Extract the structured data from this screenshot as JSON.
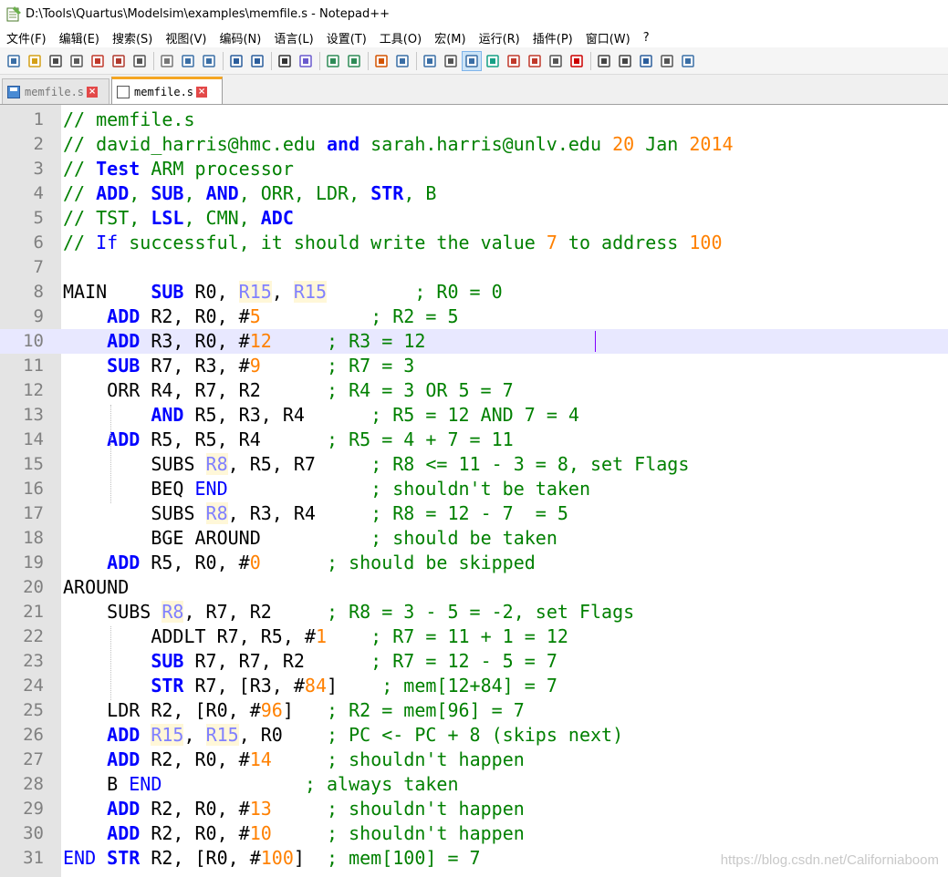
{
  "window": {
    "title": "D:\\Tools\\Quartus\\Modelsim\\examples\\memfile.s - Notepad++"
  },
  "menu": [
    "文件(F)",
    "编辑(E)",
    "搜索(S)",
    "视图(V)",
    "编码(N)",
    "语言(L)",
    "设置(T)",
    "工具(O)",
    "宏(M)",
    "运行(R)",
    "插件(P)",
    "窗口(W)",
    "?"
  ],
  "toolbar": {
    "buttons": [
      "new-file-icon",
      "open-file-icon",
      "save-icon",
      "save-all-icon",
      "close-icon",
      "close-all-icon",
      "print-icon",
      "sep",
      "cut-icon",
      "copy-icon",
      "paste-icon",
      "sep",
      "undo-icon",
      "redo-icon",
      "sep",
      "find-icon",
      "replace-icon",
      "sep",
      "zoom-in-icon",
      "zoom-out-icon",
      "sep",
      "sync-vertical-icon",
      "sync-horizontal-icon",
      "sep",
      "word-wrap-icon",
      "show-all-chars-icon",
      "indent-guide-icon",
      "user-language-icon",
      "document-map-icon",
      "function-list-icon",
      "folder-workspace-icon",
      "monitoring-icon",
      "sep",
      "record-macro-icon",
      "stop-record-icon",
      "play-macro-icon",
      "run-macro-multiple-icon",
      "save-macro-icon"
    ],
    "active": "indent-guide-icon"
  },
  "tabs": [
    {
      "label": "memfile.s",
      "active": false
    },
    {
      "label": "memfile.s",
      "active": true
    }
  ],
  "colors": {
    "comment": "#008000",
    "keyword": "#0000ff",
    "register": "#8080ff",
    "number": "#ff8000",
    "current_line": "#e8e8ff",
    "tab_accent": "#f5a623"
  },
  "editor": {
    "current_line": 10,
    "lines": [
      {
        "n": "1",
        "tokens": [
          [
            "cmt",
            "// memfile.s"
          ]
        ]
      },
      {
        "n": "2",
        "tokens": [
          [
            "cmt",
            "// david_harris@hmc.edu "
          ],
          [
            "cmt-kw",
            "and"
          ],
          [
            "cmt",
            " sarah.harris@unlv.edu "
          ],
          [
            "cmt-num",
            "20"
          ],
          [
            "cmt",
            " Jan "
          ],
          [
            "cmt-num",
            "2014"
          ]
        ]
      },
      {
        "n": "3",
        "tokens": [
          [
            "cmt",
            "// "
          ],
          [
            "cmt-kw",
            "Test"
          ],
          [
            "cmt",
            " ARM processor"
          ]
        ]
      },
      {
        "n": "4",
        "tokens": [
          [
            "cmt",
            "// "
          ],
          [
            "cmt-kw",
            "ADD"
          ],
          [
            "cmt",
            ", "
          ],
          [
            "cmt-kw",
            "SUB"
          ],
          [
            "cmt",
            ", "
          ],
          [
            "cmt-kw",
            "AND"
          ],
          [
            "cmt",
            ", ORR, LDR, "
          ],
          [
            "cmt-kw",
            "STR"
          ],
          [
            "cmt",
            ", B"
          ]
        ]
      },
      {
        "n": "5",
        "tokens": [
          [
            "cmt",
            "// TST, "
          ],
          [
            "cmt-kw",
            "LSL"
          ],
          [
            "cmt",
            ", CMN, "
          ],
          [
            "cmt-kw",
            "ADC"
          ]
        ]
      },
      {
        "n": "6",
        "tokens": [
          [
            "cmt",
            "// "
          ],
          [
            "label",
            "If"
          ],
          [
            "cmt",
            " successful, it should write the value "
          ],
          [
            "cmt-num",
            "7"
          ],
          [
            "cmt",
            " to address "
          ],
          [
            "cmt-num",
            "100"
          ]
        ]
      },
      {
        "n": "7",
        "tokens": []
      },
      {
        "n": "8",
        "tokens": [
          [
            "text",
            "MAIN    "
          ],
          [
            "kw",
            "SUB"
          ],
          [
            "text",
            " R0, "
          ],
          [
            "reg",
            "R15"
          ],
          [
            "text",
            ", "
          ],
          [
            "reg",
            "R15"
          ],
          [
            "text",
            "        "
          ],
          [
            "cmt",
            "; R0 = 0"
          ]
        ]
      },
      {
        "n": "9",
        "tokens": [
          [
            "text",
            "    "
          ],
          [
            "kw",
            "ADD"
          ],
          [
            "text",
            " R2, R0, #"
          ],
          [
            "num",
            "5"
          ],
          [
            "text",
            "          "
          ],
          [
            "cmt",
            "; R2 = 5"
          ]
        ]
      },
      {
        "n": "10",
        "tokens": [
          [
            "text",
            "    "
          ],
          [
            "kw",
            "ADD"
          ],
          [
            "text",
            " R3, R0, #"
          ],
          [
            "num",
            "12"
          ],
          [
            "text",
            "     "
          ],
          [
            "cmt",
            "; R3 = 12"
          ]
        ]
      },
      {
        "n": "11",
        "tokens": [
          [
            "text",
            "    "
          ],
          [
            "kw",
            "SUB"
          ],
          [
            "text",
            " R7, R3, #"
          ],
          [
            "num",
            "9"
          ],
          [
            "text",
            "      "
          ],
          [
            "cmt",
            "; R7 = 3"
          ]
        ]
      },
      {
        "n": "12",
        "tokens": [
          [
            "text",
            "    ORR R4, R7, R2      "
          ],
          [
            "cmt",
            "; R4 = 3 OR 5 = 7"
          ]
        ]
      },
      {
        "n": "13",
        "tokens": [
          [
            "text",
            "        "
          ],
          [
            "kw",
            "AND"
          ],
          [
            "text",
            " R5, R3, R4      "
          ],
          [
            "cmt",
            "; R5 = 12 AND 7 = 4"
          ]
        ]
      },
      {
        "n": "14",
        "tokens": [
          [
            "text",
            "    "
          ],
          [
            "kw",
            "ADD"
          ],
          [
            "text",
            " R5, R5, R4      "
          ],
          [
            "cmt",
            "; R5 = 4 + 7 = 11"
          ]
        ]
      },
      {
        "n": "15",
        "tokens": [
          [
            "text",
            "        SUBS "
          ],
          [
            "reg",
            "R8"
          ],
          [
            "text",
            ", R5, R7     "
          ],
          [
            "cmt",
            "; R8 <= 11 - 3 = 8, set Flags"
          ]
        ]
      },
      {
        "n": "16",
        "tokens": [
          [
            "text",
            "        BEQ "
          ],
          [
            "label",
            "END"
          ],
          [
            "text",
            "             "
          ],
          [
            "cmt",
            "; shouldn't be taken"
          ]
        ]
      },
      {
        "n": "17",
        "tokens": [
          [
            "text",
            "        SUBS "
          ],
          [
            "reg",
            "R8"
          ],
          [
            "text",
            ", R3, R4     "
          ],
          [
            "cmt",
            "; R8 = 12 - 7  = 5"
          ]
        ]
      },
      {
        "n": "18",
        "tokens": [
          [
            "text",
            "        BGE AROUND          "
          ],
          [
            "cmt",
            "; should be taken"
          ]
        ]
      },
      {
        "n": "19",
        "tokens": [
          [
            "text",
            "    "
          ],
          [
            "kw",
            "ADD"
          ],
          [
            "text",
            " R5, R0, #"
          ],
          [
            "num",
            "0"
          ],
          [
            "text",
            "      "
          ],
          [
            "cmt",
            "; should be skipped"
          ]
        ]
      },
      {
        "n": "20",
        "tokens": [
          [
            "text",
            "AROUND"
          ]
        ]
      },
      {
        "n": "21",
        "tokens": [
          [
            "text",
            "    SUBS "
          ],
          [
            "reg",
            "R8"
          ],
          [
            "text",
            ", R7, R2     "
          ],
          [
            "cmt",
            "; R8 = 3 - 5 = -2, set Flags"
          ]
        ]
      },
      {
        "n": "22",
        "tokens": [
          [
            "text",
            "        ADDLT R7, R5, #"
          ],
          [
            "num",
            "1"
          ],
          [
            "text",
            "    "
          ],
          [
            "cmt",
            "; R7 = 11 + 1 = 12"
          ]
        ]
      },
      {
        "n": "23",
        "tokens": [
          [
            "text",
            "        "
          ],
          [
            "kw",
            "SUB"
          ],
          [
            "text",
            " R7, R7, R2      "
          ],
          [
            "cmt",
            "; R7 = 12 - 5 = 7"
          ]
        ]
      },
      {
        "n": "24",
        "tokens": [
          [
            "text",
            "        "
          ],
          [
            "kw",
            "STR"
          ],
          [
            "text",
            " R7, [R3, #"
          ],
          [
            "num",
            "84"
          ],
          [
            "text",
            "]    "
          ],
          [
            "cmt",
            "; mem[12+84] = 7"
          ]
        ]
      },
      {
        "n": "25",
        "tokens": [
          [
            "text",
            "    LDR R2, [R0, #"
          ],
          [
            "num",
            "96"
          ],
          [
            "text",
            "]   "
          ],
          [
            "cmt",
            "; R2 = mem[96] = 7"
          ]
        ]
      },
      {
        "n": "26",
        "tokens": [
          [
            "text",
            "    "
          ],
          [
            "kw",
            "ADD"
          ],
          [
            "text",
            " "
          ],
          [
            "reg",
            "R15"
          ],
          [
            "text",
            ", "
          ],
          [
            "reg",
            "R15"
          ],
          [
            "text",
            ", R0    "
          ],
          [
            "cmt",
            "; PC <- PC + 8 (skips next)"
          ]
        ]
      },
      {
        "n": "27",
        "tokens": [
          [
            "text",
            "    "
          ],
          [
            "kw",
            "ADD"
          ],
          [
            "text",
            " R2, R0, #"
          ],
          [
            "num",
            "14"
          ],
          [
            "text",
            "     "
          ],
          [
            "cmt",
            "; shouldn't happen"
          ]
        ]
      },
      {
        "n": "28",
        "tokens": [
          [
            "text",
            "    B "
          ],
          [
            "label",
            "END"
          ],
          [
            "text",
            "             "
          ],
          [
            "cmt",
            "; always taken"
          ]
        ]
      },
      {
        "n": "29",
        "tokens": [
          [
            "text",
            "    "
          ],
          [
            "kw",
            "ADD"
          ],
          [
            "text",
            " R2, R0, #"
          ],
          [
            "num",
            "13"
          ],
          [
            "text",
            "     "
          ],
          [
            "cmt",
            "; shouldn't happen"
          ]
        ]
      },
      {
        "n": "30",
        "tokens": [
          [
            "text",
            "    "
          ],
          [
            "kw",
            "ADD"
          ],
          [
            "text",
            " R2, R0, #"
          ],
          [
            "num",
            "10"
          ],
          [
            "text",
            "     "
          ],
          [
            "cmt",
            "; shouldn't happen"
          ]
        ]
      },
      {
        "n": "31",
        "tokens": [
          [
            "label",
            "END"
          ],
          [
            "text",
            " "
          ],
          [
            "kw",
            "STR"
          ],
          [
            "text",
            " R2, [R0, #"
          ],
          [
            "num",
            "100"
          ],
          [
            "text",
            "]  "
          ],
          [
            "cmt",
            "; mem[100] = 7"
          ]
        ]
      }
    ]
  },
  "watermark": "https://blog.csdn.net/Californiaboom"
}
